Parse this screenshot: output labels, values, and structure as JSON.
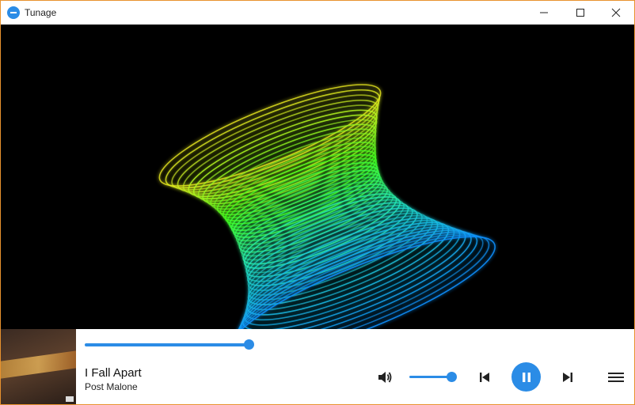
{
  "window": {
    "title": "Tunage",
    "accent": "#2b8ce6",
    "icons": {
      "app": "tunage-logo-icon",
      "minimize": "minimize-icon",
      "maximize": "maximize-icon",
      "close": "close-icon"
    }
  },
  "visualizer": {
    "background": "#000000",
    "colors": [
      "#f0f020",
      "#40ff20",
      "#20e0d0",
      "#1090ff"
    ]
  },
  "player": {
    "track_title": "I Fall Apart",
    "artist": "Post Malone",
    "progress_fraction": 0.2,
    "volume_fraction": 0.9,
    "state": "playing",
    "icons": {
      "volume": "volume-icon",
      "previous": "skip-previous-icon",
      "pause": "pause-icon",
      "next": "skip-next-icon",
      "menu": "hamburger-menu-icon"
    }
  }
}
